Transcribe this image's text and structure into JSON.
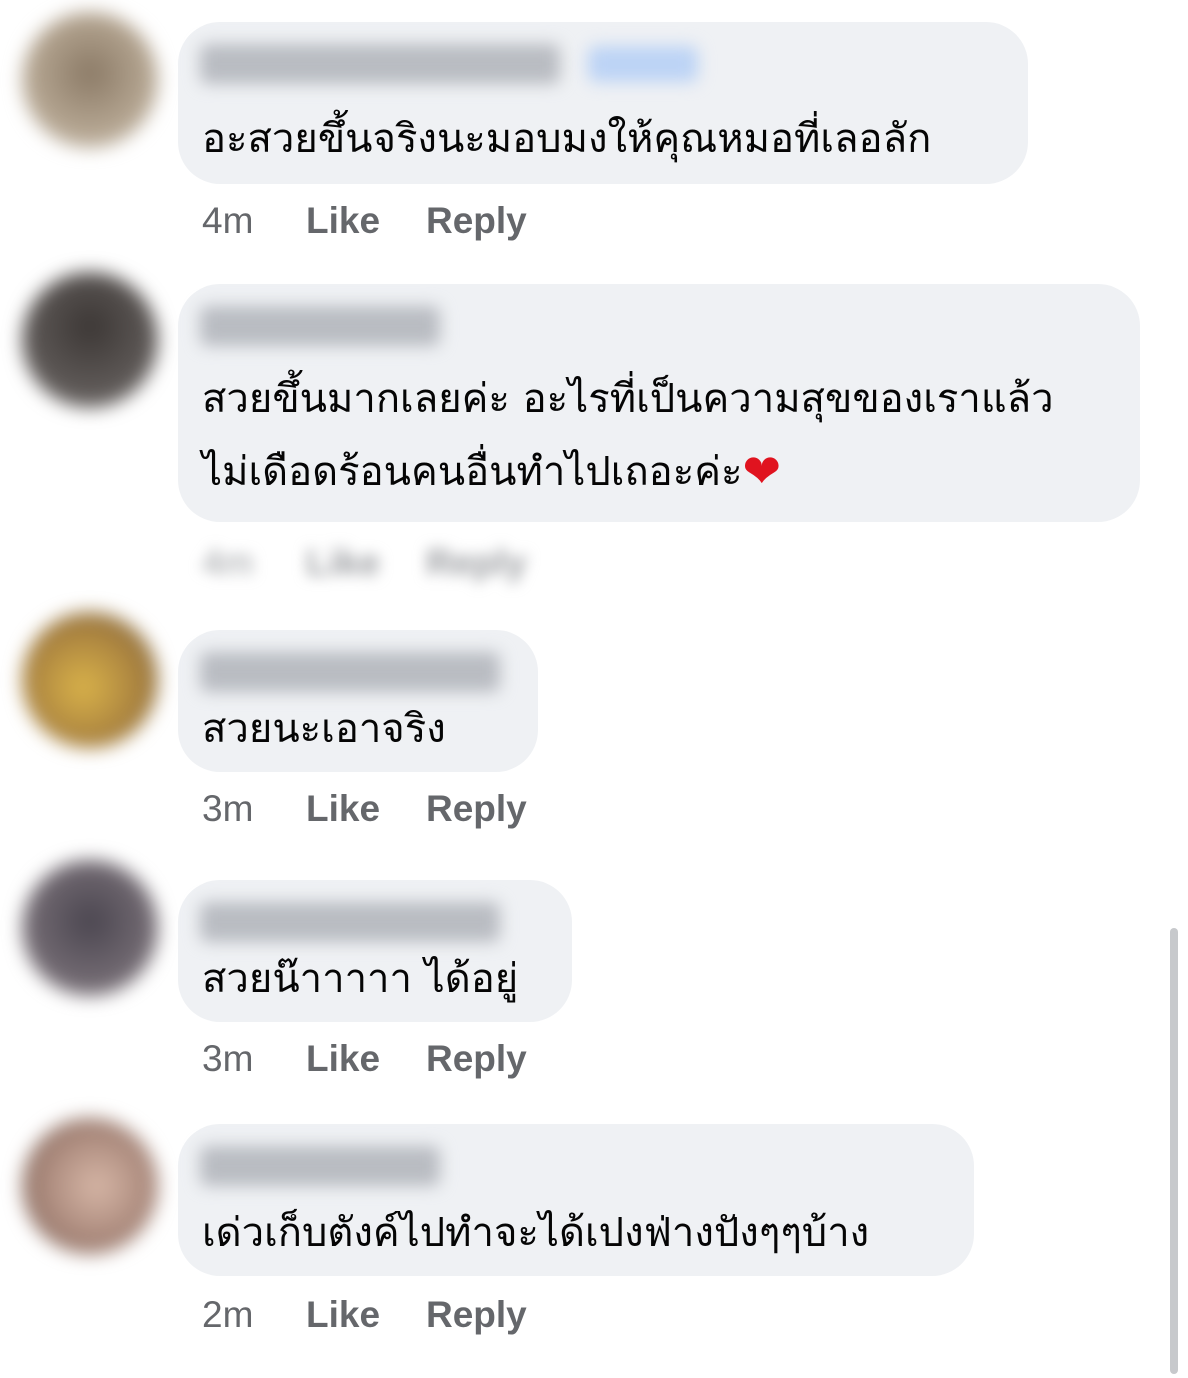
{
  "comments": [
    {
      "text_lines": [
        "อะสวยขึ้นจริงนะมอบมงให้คุณหมอที่เลอลัก"
      ],
      "time": "4m",
      "like": "Like",
      "reply": "Reply"
    },
    {
      "text_lines": [
        "สวยขึ้นมากเลยค่ะ อะไรที่เป็นความสุขของเราแล้ว",
        "ไม่เดือดร้อนคนอื่นทำไปเถอะค่ะ"
      ],
      "emoji": "❤",
      "time": "4m",
      "like": "Like",
      "reply": "Reply"
    },
    {
      "text_lines": [
        "สวยนะเอาจริง"
      ],
      "time": "3m",
      "like": "Like",
      "reply": "Reply"
    },
    {
      "text_lines": [
        "สวยน๊าาาาา ได้อยู่"
      ],
      "time": "3m",
      "like": "Like",
      "reply": "Reply"
    },
    {
      "text_lines": [
        "เด่วเก็บตังค์ไปทำจะได้เปงฟ่างปังๆๆบ้าง"
      ],
      "time": "2m",
      "like": "Like",
      "reply": "Reply"
    }
  ],
  "colors": {
    "bubble": "#eff1f4",
    "meta_text": "#65676b",
    "heart": "#e0131f"
  }
}
